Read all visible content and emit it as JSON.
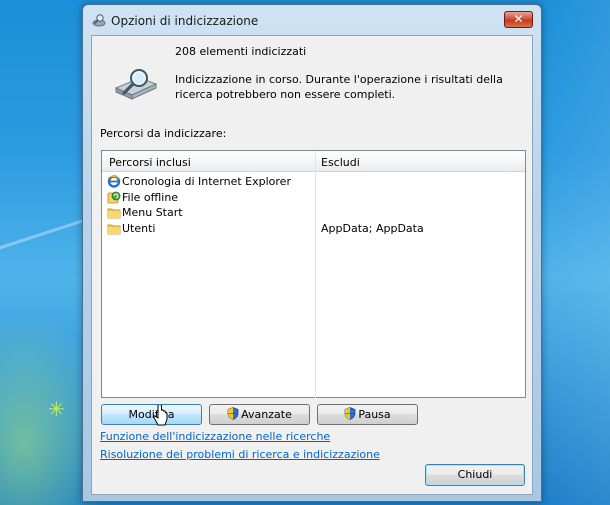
{
  "window": {
    "title": "Opzioni di indicizzazione",
    "close_glyph": "✕"
  },
  "summary": {
    "count_text": "208 elementi indicizzati",
    "status_text": "Indicizzazione in corso. Durante l'operazione i risultati della ricerca potrebbero non essere completi."
  },
  "paths": {
    "label": "Percorsi da indicizzare:",
    "columns": [
      "Percorsi inclusi",
      "Escludi"
    ],
    "rows": [
      {
        "name": "Cronologia di Internet Explorer",
        "exclude": "",
        "icon": "internet-explorer-icon"
      },
      {
        "name": "File offline",
        "exclude": "",
        "icon": "offline-files-icon"
      },
      {
        "name": "Menu Start",
        "exclude": "",
        "icon": "folder-icon"
      },
      {
        "name": "Utenti",
        "exclude": "AppData; AppData",
        "icon": "folder-icon"
      }
    ]
  },
  "buttons": {
    "modify": "Modifica",
    "advanced": "Avanzate",
    "pause": "Pausa",
    "close": "Chiudi"
  },
  "links": {
    "indexing_in_search": "Funzione dell'indicizzazione nelle ricerche",
    "troubleshoot": "Risoluzione dei problemi di ricerca e indicizzazione"
  },
  "colors": {
    "link": "#0066cc",
    "desktop": "#2c9be0",
    "close_button": "#c33a1f"
  }
}
